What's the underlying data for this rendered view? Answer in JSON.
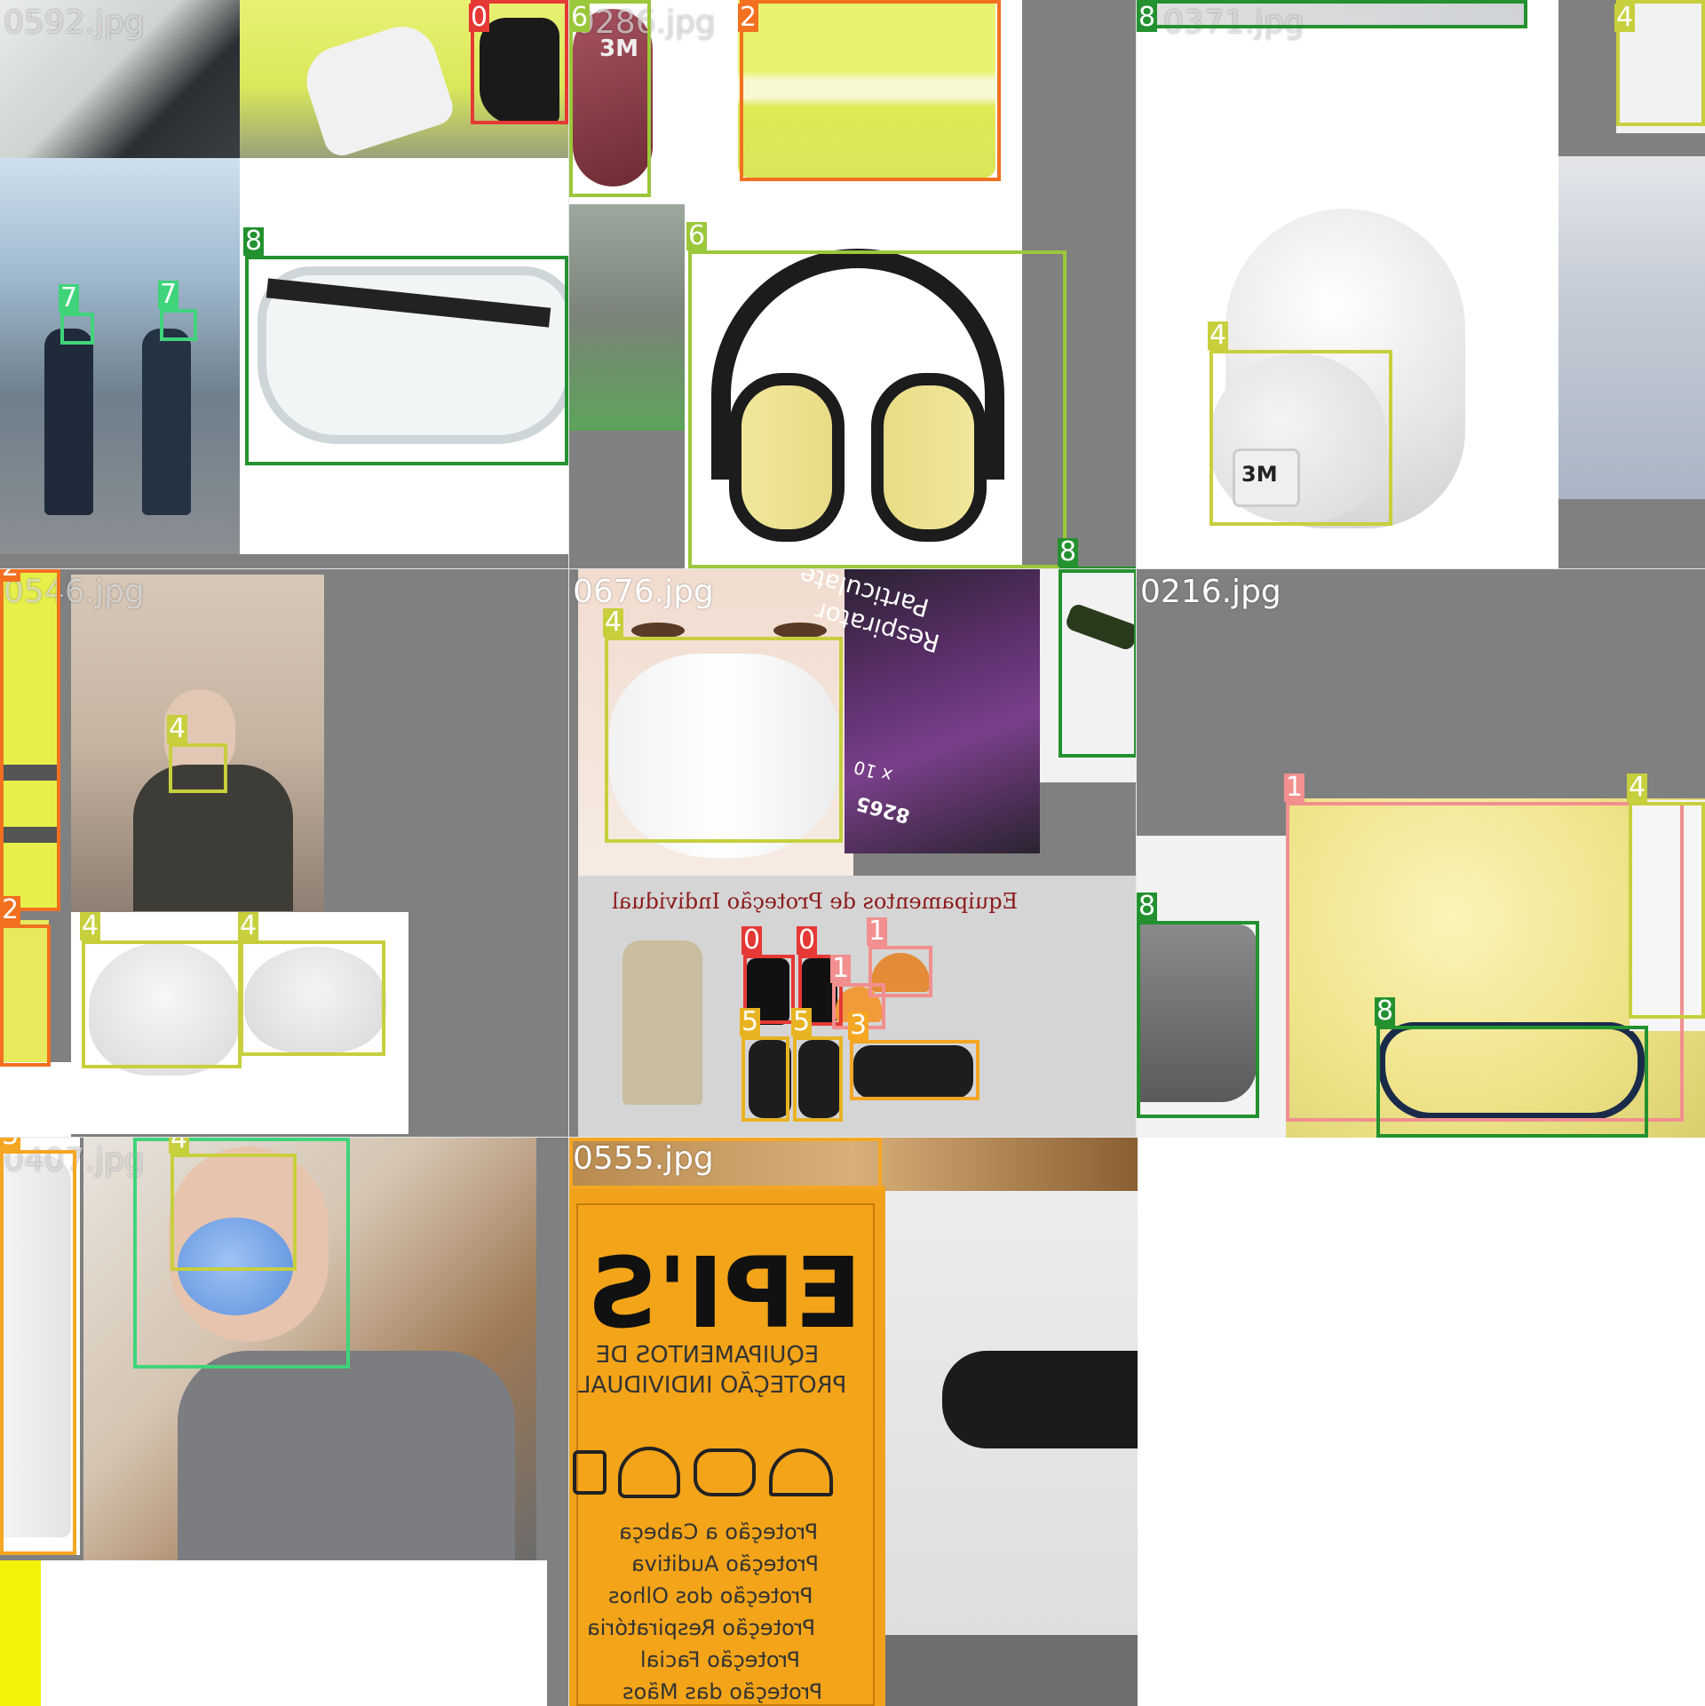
{
  "mosaic": {
    "tiles": [
      {
        "name": "0592.jpg",
        "faded": true
      },
      {
        "name": "0286.jpg",
        "faded": true
      },
      {
        "name": "0371.jpg",
        "faded": true
      },
      {
        "name": "0546.jpg",
        "faded": true
      },
      {
        "name": "0676.jpg",
        "faded": false
      },
      {
        "name": "0216.jpg",
        "faded": false
      },
      {
        "name": "0407.jpg",
        "faded": true
      },
      {
        "name": "0555.jpg",
        "faded": false
      }
    ]
  },
  "classes": {
    "0": {
      "label": "0",
      "color": "#e53935"
    },
    "1": {
      "label": "1",
      "color": "#f28f8f"
    },
    "2": {
      "label": "2",
      "color": "#f2701f"
    },
    "3": {
      "label": "3",
      "color": "#f5a623"
    },
    "4": {
      "label": "4",
      "color": "#c7cf3d"
    },
    "5": {
      "label": "5",
      "color": "#e8b321"
    },
    "6": {
      "label": "6",
      "color": "#9bc73a"
    },
    "7": {
      "label": "7",
      "color": "#3fd47a"
    },
    "8": {
      "label": "8",
      "color": "#23912f"
    }
  },
  "posters": {
    "ppe_title": "Equipamentos de Proteção Individual",
    "respirator_box_line1": "Particulate",
    "respirator_box_line2": "Respirator",
    "respirator_box_count": "x 10",
    "respirator_box_code": "8265",
    "epis_title": "EPI'S",
    "epis_sub1": "EQUIPAMENTOS DE",
    "epis_sub2": "PROTEÇÃO INDIVIDUAL",
    "epis_list": [
      "Proteção a Cabeça",
      "Proteção Auditiva",
      "Proteção dos Olhos",
      "Proteção Respiratória",
      "Proteção Facial",
      "Proteção das Mãos"
    ],
    "mask_brand": "3M"
  }
}
